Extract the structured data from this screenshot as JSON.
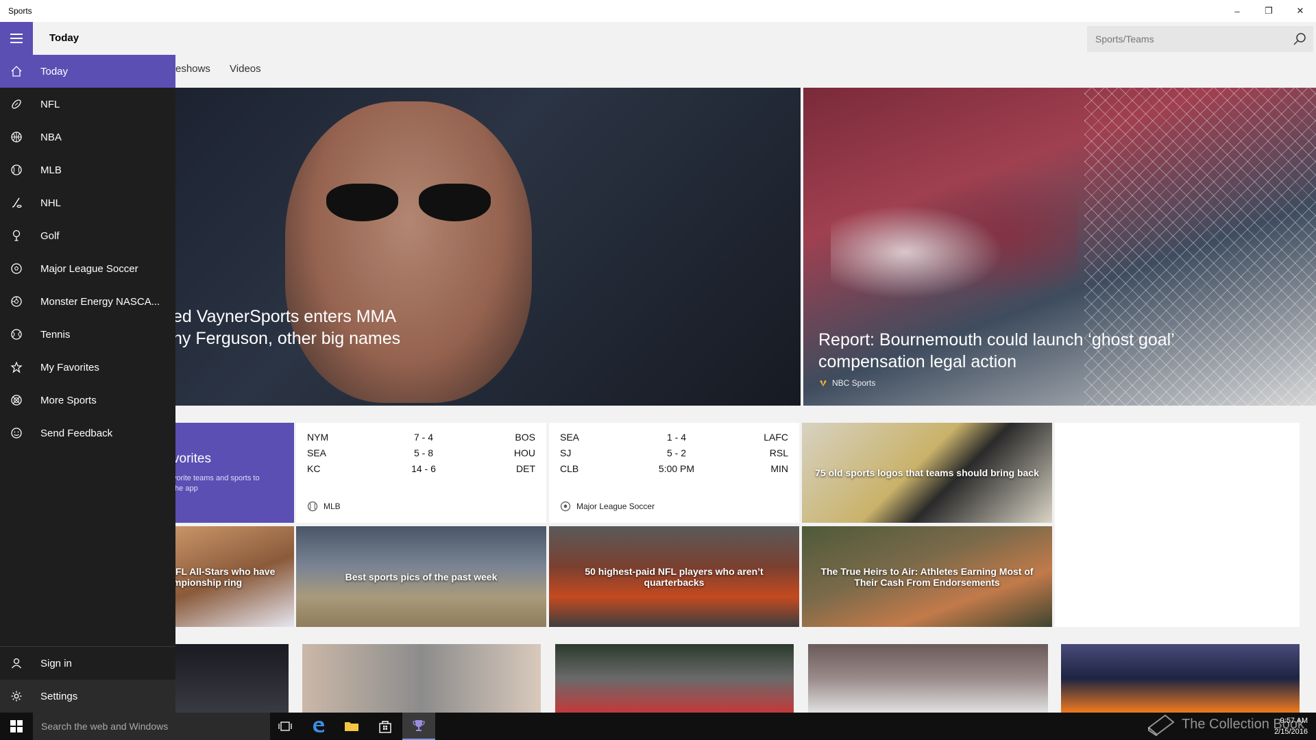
{
  "window": {
    "title": "Sports",
    "minimize": "–",
    "restore": "❐",
    "close": "✕"
  },
  "header": {
    "title": "Today",
    "search_placeholder": "Sports/Teams"
  },
  "subnav": {
    "items": [
      "eshows",
      "Videos"
    ]
  },
  "hero": [
    {
      "headline_line1": "ed VaynerSports enters MMA",
      "headline_line2": "ny Ferguson, other big names"
    },
    {
      "headline_line1": "Report: Bournemouth could launch ‘ghost goal’",
      "headline_line2": "compensation legal action",
      "source": "NBC Sports"
    }
  ],
  "favorites_tile": {
    "title": "vorites",
    "subtitle_line1": "vorite teams and sports to",
    "subtitle_line2": "the app"
  },
  "scores": [
    {
      "league": "MLB",
      "games": [
        {
          "team1": "NYM",
          "score": "7 - 4",
          "team2": "BOS"
        },
        {
          "team1": "SEA",
          "score": "5 - 8",
          "team2": "HOU"
        },
        {
          "team1": "KC",
          "score": "14 - 6",
          "team2": "DET"
        }
      ]
    },
    {
      "league": "Major League Soccer",
      "games": [
        {
          "team1": "SEA",
          "score": "1 - 4",
          "team2": "LAFC"
        },
        {
          "team1": "SJ",
          "score": "5 - 2",
          "team2": "RSL"
        },
        {
          "team1": "CLB",
          "score": "5:00 PM",
          "team2": "MIN"
        }
      ]
    }
  ],
  "tiles": {
    "logos": "75 old sports logos that teams should bring back",
    "allstars_line1": "IFL All-Stars who have",
    "allstars_line2": "mpionship ring",
    "pics": "Best sports pics of the past week",
    "nfl_paid": "50 highest-paid NFL players who aren’t quarterbacks",
    "heirs": "The True Heirs to Air: Athletes Earning Most of Their Cash From Endorsements"
  },
  "nav": {
    "items": [
      {
        "label": "Today",
        "icon": "home-icon"
      },
      {
        "label": "NFL",
        "icon": "football-icon"
      },
      {
        "label": "NBA",
        "icon": "basketball-icon"
      },
      {
        "label": "MLB",
        "icon": "baseball-icon"
      },
      {
        "label": "NHL",
        "icon": "hockey-icon"
      },
      {
        "label": "Golf",
        "icon": "golf-icon"
      },
      {
        "label": "Major League Soccer",
        "icon": "soccer-icon"
      },
      {
        "label": "Monster Energy NASCA...",
        "icon": "racing-icon"
      },
      {
        "label": "Tennis",
        "icon": "tennis-icon"
      },
      {
        "label": "My Favorites",
        "icon": "favorites-icon"
      },
      {
        "label": "More Sports",
        "icon": "more-sports-icon"
      },
      {
        "label": "Send Feedback",
        "icon": "smiley-icon"
      }
    ],
    "bottom": [
      {
        "label": "Sign in",
        "icon": "person-icon"
      },
      {
        "label": "Settings",
        "icon": "gear-icon"
      }
    ]
  },
  "taskbar": {
    "search": "Search the web and Windows",
    "time": "9:57 AM",
    "date": "2/15/2016",
    "watermark": "The Collection Book"
  },
  "colors": {
    "accent": "#5b4fb4",
    "nav_bg": "#1e1e1e",
    "taskbar": "#101010"
  }
}
